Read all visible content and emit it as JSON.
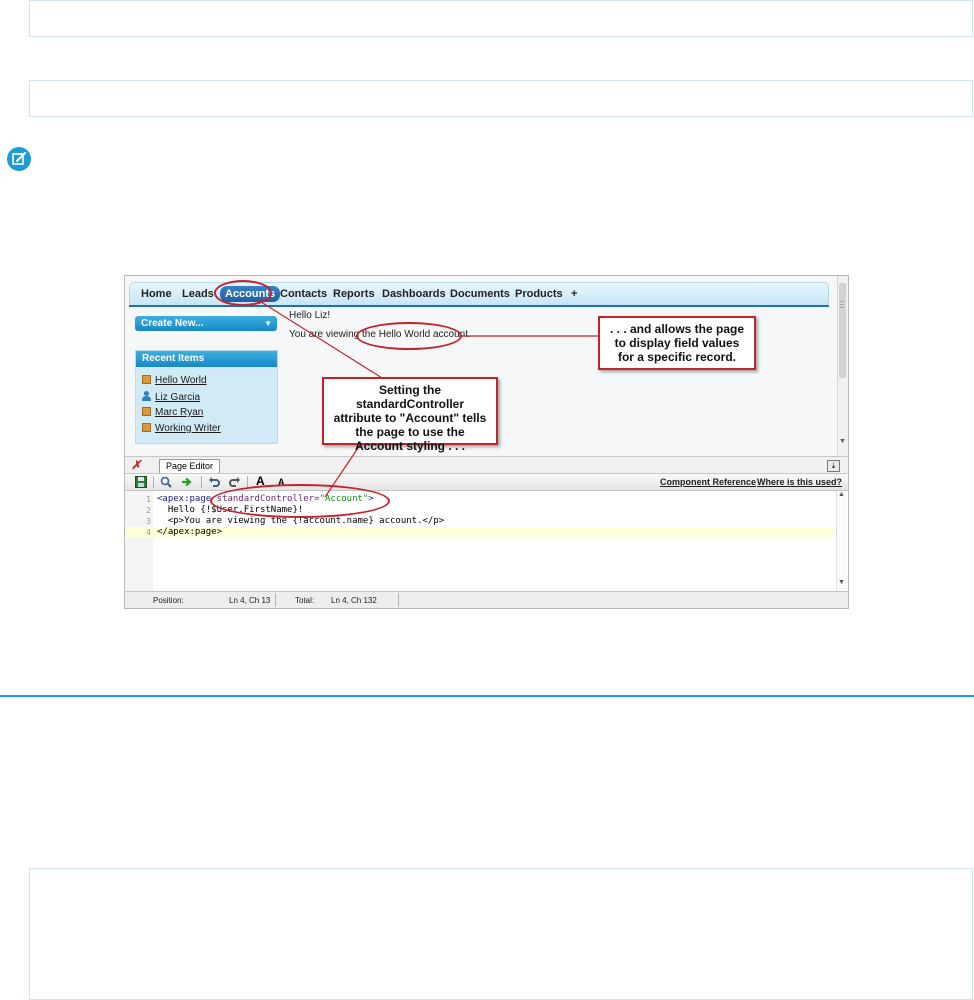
{
  "tabs": [
    "Home",
    "Leads",
    "Accounts",
    "Contacts",
    "Reports",
    "Dashboards",
    "Documents",
    "Products",
    "+"
  ],
  "sidebar": {
    "create_new": "Create New...",
    "recent_title": "Recent Items",
    "recent_items": [
      "Hello World",
      "Liz Garcia",
      "Marc Ryan",
      "Working Writer"
    ]
  },
  "main": {
    "greeting": "Hello Liz!",
    "viewing": "You are viewing the Hello World account."
  },
  "editor": {
    "tab_label": "Page Editor",
    "links": {
      "component_reference": "Component Reference",
      "where_used": "Where is this used?"
    },
    "font_large": "A",
    "font_small": "A",
    "lines": [
      {
        "num": "1",
        "parts": [
          "<apex:page",
          " standardController=",
          "\"Account\"",
          ">"
        ]
      },
      {
        "num": "2",
        "text": "  Hello {!$User.FirstName}!"
      },
      {
        "num": "3",
        "text": "  <p>You are viewing the {!account.name} account.</p>"
      },
      {
        "num": "4",
        "text": "</apex:page>"
      }
    ]
  },
  "status": {
    "position_label": "Position:",
    "position_value": "Ln 4, Ch 13",
    "total_label": "Total:",
    "total_value": "Ln 4, Ch 132"
  },
  "callouts": {
    "right": ". . . and allows the page to display field values for a specific record.",
    "center": "Setting the standardController attribute to \"Account\" tells the page to use the Account styling . . ."
  },
  "colors": {
    "accent_rule": "#1e9bd7",
    "callout_red": "#c3242b",
    "tab_active": "#1f5ea3"
  }
}
